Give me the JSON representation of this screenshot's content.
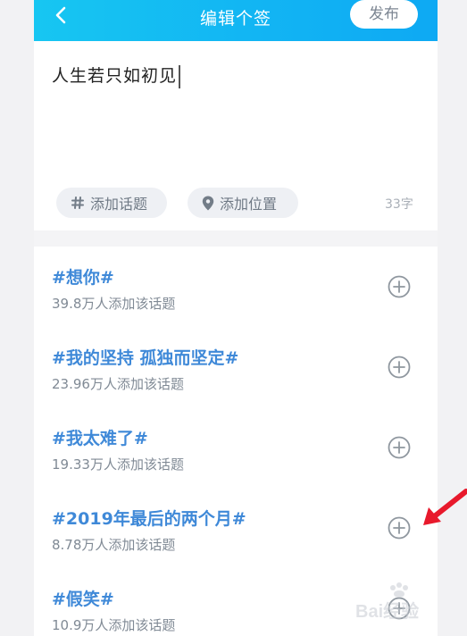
{
  "header": {
    "title": "编辑个签",
    "publish_label": "发布"
  },
  "editor": {
    "text": "人生若只如初见",
    "add_topic_label": "添加话题",
    "add_location_label": "添加位置",
    "char_count": "33字"
  },
  "topics": [
    {
      "title": "#想你#",
      "subtitle": "39.8万人添加该话题"
    },
    {
      "title": "#我的坚持 孤独而坚定#",
      "subtitle": "23.96万人添加该话题"
    },
    {
      "title": "#我太难了#",
      "subtitle": "19.33万人添加该话题"
    },
    {
      "title": "#2019年最后的两个月#",
      "subtitle": "8.78万人添加该话题"
    },
    {
      "title": "#假笑#",
      "subtitle": "10.9万人添加该话题"
    }
  ],
  "watermark": {
    "text": "Bai经验"
  },
  "colors": {
    "header_start": "#17c6f2",
    "header_end": "#0ea9f3",
    "topic_title": "#3f89d8",
    "annotation_arrow": "#e8192c"
  },
  "icons": {
    "back": "chevron-left-icon",
    "topic": "hash-icon",
    "location": "location-pin-icon",
    "add": "plus-circle-icon",
    "annotation": "red-arrow-icon"
  }
}
